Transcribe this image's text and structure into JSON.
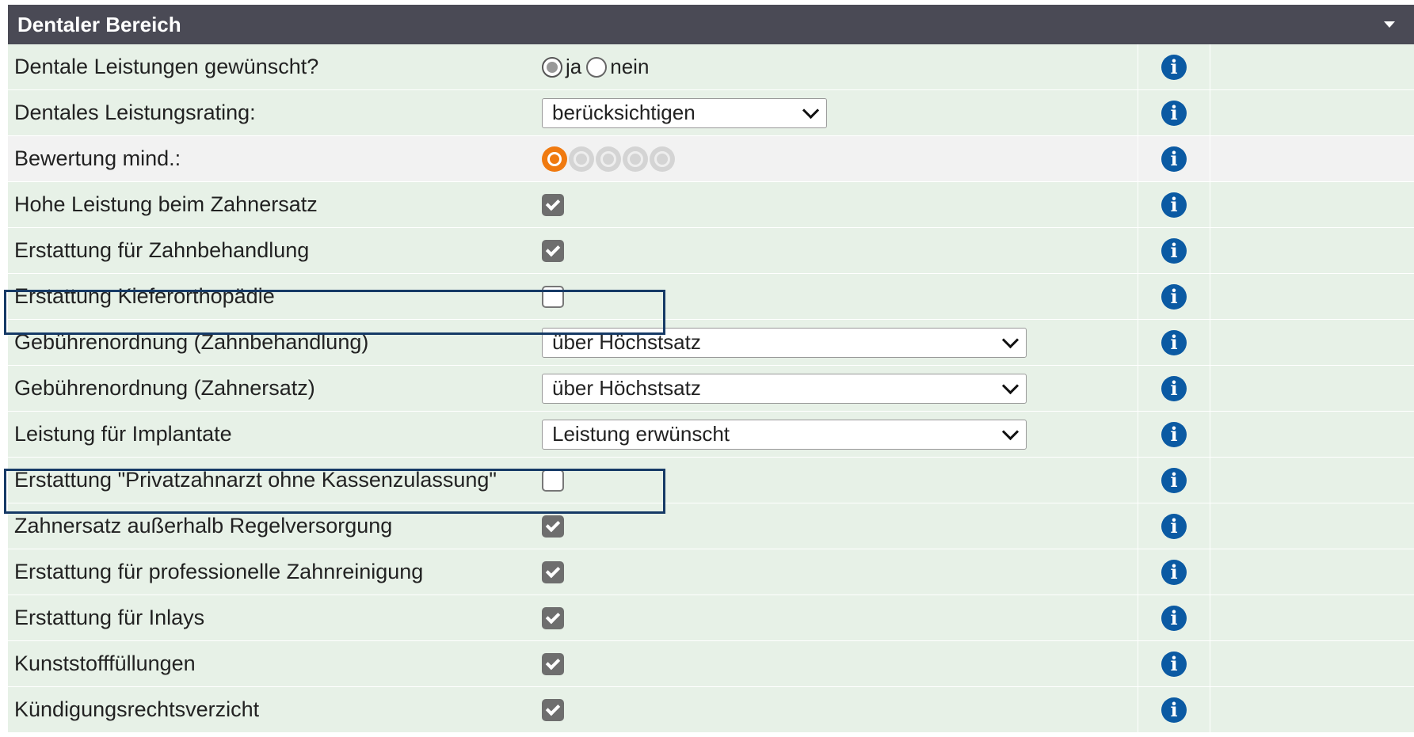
{
  "section": {
    "title": "Dentaler Bereich"
  },
  "colors": {
    "header_bg": "#4a4a55",
    "row_bg": "#e7f1e7",
    "row_alt_bg": "#f2f2f2",
    "info_icon": "#0b5aa3",
    "highlight_border": "#163a66",
    "rating_active": "#f07a10"
  },
  "rows": [
    {
      "label": "Dentale Leistungen gewünscht?",
      "control": "radio",
      "options": [
        "ja",
        "nein"
      ],
      "selected": "ja"
    },
    {
      "label": "Dentales Leistungsrating:",
      "control": "select",
      "value": "berücksichtigen"
    },
    {
      "label": "Bewertung mind.:",
      "control": "rating",
      "rating": 1,
      "max": 5
    },
    {
      "label": "Hohe Leistung beim Zahnersatz",
      "control": "checkbox",
      "checked": true
    },
    {
      "label": "Erstattung für Zahnbehandlung",
      "control": "checkbox",
      "checked": true
    },
    {
      "label": "Erstattung Kieferorthopädie",
      "control": "checkbox",
      "checked": false
    },
    {
      "label": "Gebührenordnung (Zahnbehandlung)",
      "control": "select",
      "value": "über Höchstsatz"
    },
    {
      "label": "Gebührenordnung (Zahnersatz)",
      "control": "select",
      "value": "über Höchstsatz"
    },
    {
      "label": "Leistung für Implantate",
      "control": "select",
      "value": "Leistung erwünscht"
    },
    {
      "label": "Erstattung \"Privatzahnarzt ohne Kassenzulassung\"",
      "control": "checkbox",
      "checked": false
    },
    {
      "label": "Zahnersatz außerhalb Regelversorgung",
      "control": "checkbox",
      "checked": true
    },
    {
      "label": "Erstattung für professionelle Zahnreinigung",
      "control": "checkbox",
      "checked": true
    },
    {
      "label": "Erstattung für Inlays",
      "control": "checkbox",
      "checked": true
    },
    {
      "label": "Kunststofffüllungen",
      "control": "checkbox",
      "checked": true
    },
    {
      "label": "Kündigungsrechtsverzicht",
      "control": "checkbox",
      "checked": true
    }
  ]
}
